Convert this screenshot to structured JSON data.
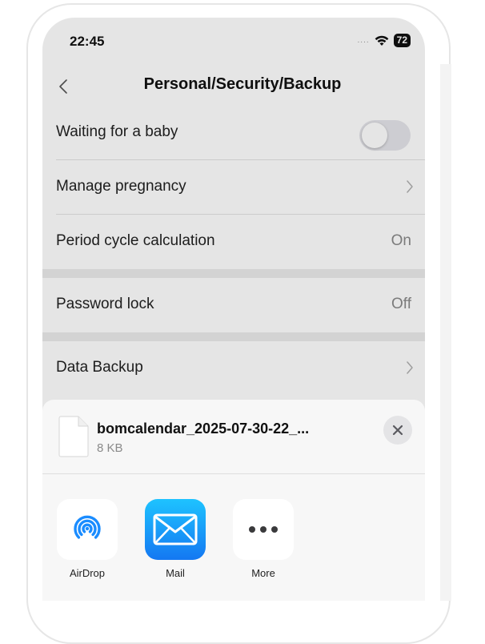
{
  "status_bar": {
    "time": "22:45",
    "signal": "....",
    "battery": "72"
  },
  "nav": {
    "title": "Personal/Security/Backup",
    "back_icon": "chevron-left-icon"
  },
  "settings": {
    "waiting_for_baby": {
      "label": "Waiting for a baby",
      "enabled": false
    },
    "manage_pregnancy": {
      "label": "Manage pregnancy"
    },
    "period_cycle": {
      "label": "Period cycle calculation",
      "value": "On"
    },
    "password_lock": {
      "label": "Password lock",
      "value": "Off"
    },
    "data_backup": {
      "label": "Data Backup"
    }
  },
  "share_sheet": {
    "file_name": "bomcalendar_2025-07-30-22_...",
    "file_size": "8 KB",
    "close_icon": "close-icon",
    "apps": [
      {
        "label": "AirDrop",
        "icon": "airdrop-icon",
        "color": "#1a8cff"
      },
      {
        "label": "Mail",
        "icon": "mail-icon",
        "color": "#1478f2"
      },
      {
        "label": "More",
        "icon": "more-icon",
        "color": "#3a3a3c"
      }
    ]
  },
  "colors": {
    "accent": "#1478f2",
    "dim_overlay": "rgba(0,0,0,0.1)"
  }
}
